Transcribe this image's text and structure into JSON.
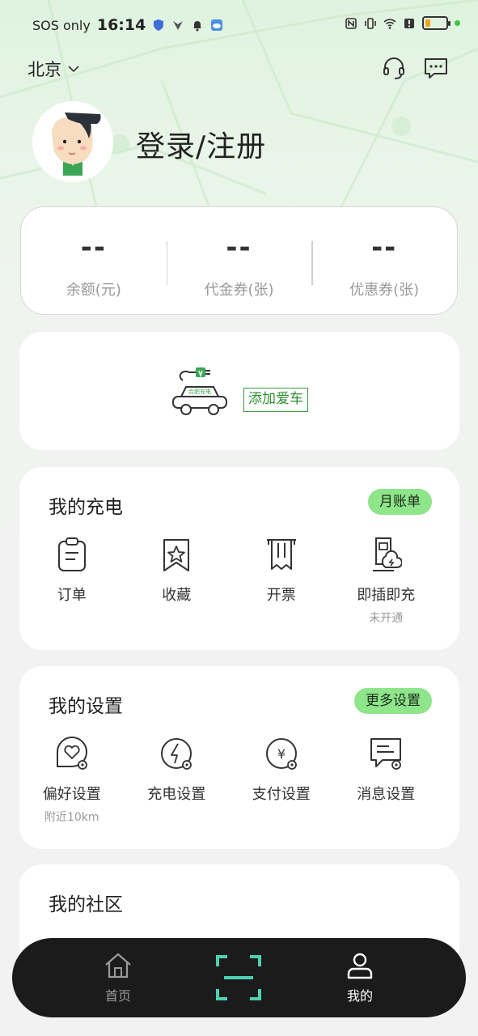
{
  "status_bar": {
    "carrier": "SOS only",
    "time": "16:14",
    "battery_level": 0.25,
    "icons": [
      "shield-icon",
      "app-icon",
      "bell-icon",
      "weather-icon",
      "nfc-icon",
      "vibrate-icon",
      "wifi-icon",
      "alert-icon",
      "battery-icon"
    ]
  },
  "header": {
    "city": "北京",
    "icons": [
      "headset-icon",
      "message-icon"
    ]
  },
  "profile": {
    "login_label": "登录/注册"
  },
  "stats": [
    {
      "value": "--",
      "label": "余额(元)"
    },
    {
      "value": "--",
      "label": "代金券(张)"
    },
    {
      "value": "--",
      "label": "优惠券(张)"
    }
  ],
  "car": {
    "car_badge": "合肥充电",
    "add_label": "添加爱车"
  },
  "charging": {
    "title": "我的充电",
    "pill": "月账单",
    "items": [
      {
        "label": "订单",
        "sub": "",
        "icon": "order-icon"
      },
      {
        "label": "收藏",
        "sub": "",
        "icon": "favorite-icon"
      },
      {
        "label": "开票",
        "sub": "",
        "icon": "invoice-icon"
      },
      {
        "label": "即插即充",
        "sub": "未开通",
        "icon": "plug-charge-icon"
      }
    ]
  },
  "settings": {
    "title": "我的设置",
    "pill": "更多设置",
    "items": [
      {
        "label": "偏好设置",
        "sub": "附近10km",
        "icon": "preference-settings-icon"
      },
      {
        "label": "充电设置",
        "sub": "",
        "icon": "charge-settings-icon"
      },
      {
        "label": "支付设置",
        "sub": "",
        "icon": "payment-settings-icon"
      },
      {
        "label": "消息设置",
        "sub": "",
        "icon": "message-settings-icon"
      }
    ]
  },
  "community": {
    "title": "我的社区"
  },
  "bottom_nav": {
    "home": "首页",
    "me": "我的",
    "accent": "#4fd1b1"
  },
  "colors": {
    "brand_green": "#8ee58a",
    "add_car_green": "#2f8f2f"
  }
}
